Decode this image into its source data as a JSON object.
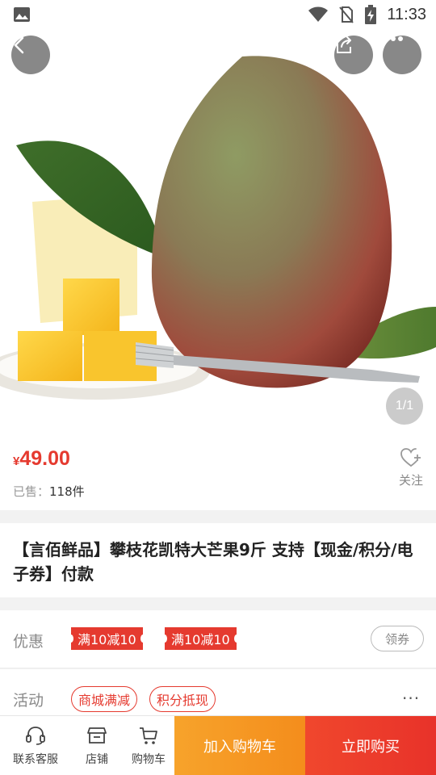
{
  "status_bar": {
    "time": "11:33",
    "icons": [
      "image-icon",
      "wifi-icon",
      "no-sim-icon",
      "battery-charging-icon"
    ]
  },
  "hero": {
    "image_counter": "1/1",
    "image_subject": "mango-with-fork"
  },
  "header_buttons": {
    "back_icon": "chevron-left-icon",
    "share_icon": "share-icon",
    "more_icon": "more-dots-icon"
  },
  "price": {
    "currency": "¥",
    "amount": "49.00",
    "sold_label": "已售：",
    "sold_count": "118件",
    "follow_label": "关注",
    "follow_icon": "heart-plus-icon"
  },
  "product": {
    "title": "【言佰鲜品】攀枝花凯特大芒果9斤 支持【现金/积分/电子券】付款"
  },
  "coupons": {
    "label": "优惠",
    "tags": [
      "满10减10",
      "满10减10"
    ],
    "claim_label": "领券"
  },
  "activities": {
    "label": "活动",
    "tags": [
      "商城满减",
      "积分抵现"
    ],
    "more": "···"
  },
  "bottom_bar": {
    "service_label": "联系客服",
    "store_label": "店铺",
    "cart_label": "购物车",
    "add_cart_label": "加入购物车",
    "buy_now_label": "立即购买"
  },
  "colors": {
    "accent_red": "#e53a2f",
    "orange": "#f7a32b"
  }
}
